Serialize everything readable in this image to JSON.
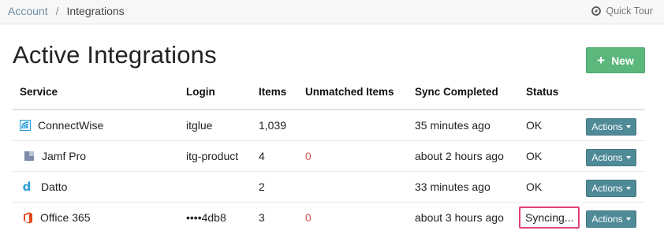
{
  "breadcrumb": {
    "parent": "Account",
    "separator": "/",
    "current": "Integrations"
  },
  "quick_tour": {
    "label": "Quick Tour",
    "icon": "compass-icon"
  },
  "page": {
    "title": "Active Integrations"
  },
  "new_button": {
    "label": "New",
    "icon": "plus-icon",
    "color": "#5cb77d"
  },
  "table": {
    "headers": {
      "service": "Service",
      "login": "Login",
      "items": "Items",
      "unmatched": "Unmatched Items",
      "sync": "Sync Completed",
      "status": "Status"
    },
    "rows": [
      {
        "service": "ConnectWise",
        "icon": "connectwise-icon",
        "login": "itglue",
        "items": "1,039",
        "unmatched": "",
        "sync": "35 minutes ago",
        "status": "OK",
        "actions": "Actions"
      },
      {
        "service": "Jamf Pro",
        "icon": "jamf-pro-icon",
        "login": "itg-product",
        "items": "4",
        "unmatched": "0",
        "sync": "about 2 hours ago",
        "status": "OK",
        "actions": "Actions"
      },
      {
        "service": "Datto",
        "icon": "datto-icon",
        "login": "",
        "items": "2",
        "unmatched": "",
        "sync": "33 minutes ago",
        "status": "OK",
        "actions": "Actions"
      },
      {
        "service": "Office 365",
        "icon": "office-365-icon",
        "login": "••••4db8",
        "items": "3",
        "unmatched": "0",
        "sync": "about 3 hours ago",
        "status": "Syncing...",
        "actions": "Actions"
      }
    ]
  },
  "colors": {
    "action_button": "#4f8a97",
    "unmatched_red": "#d9534f",
    "highlight_border": "#e4407a"
  }
}
